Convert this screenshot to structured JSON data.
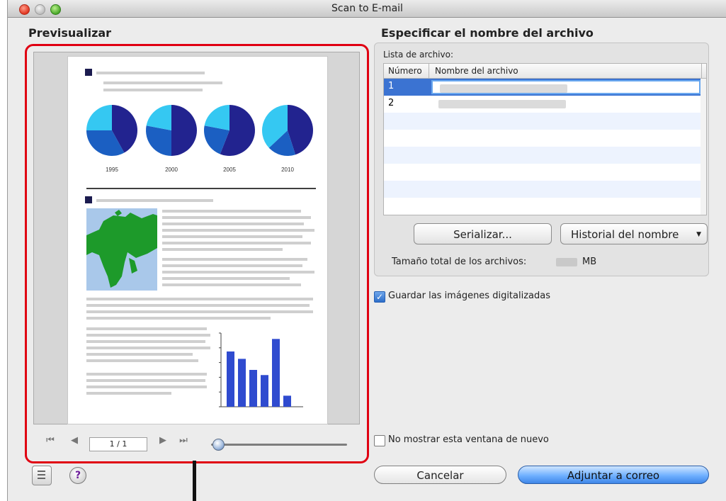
{
  "window": {
    "title": "Scan to E-mail"
  },
  "preview": {
    "section_title": "Previsualizar",
    "page_indicator": "1 / 1",
    "zoom_level": 0.05,
    "pie_years": [
      "1995",
      "2000",
      "2005",
      "2010"
    ],
    "bar_values": [
      75,
      65,
      50,
      43,
      92,
      15
    ]
  },
  "filename": {
    "section_title": "Especificar el nombre del archivo",
    "list_label": "Lista de archivo:",
    "columns": [
      "Número",
      "Nombre del archivo"
    ],
    "rows": [
      {
        "num": "1"
      },
      {
        "num": "2"
      }
    ],
    "serialize_button": "Serializar...",
    "history_button": "Historial del nombre",
    "total_size_label": "Tamaño total de los archivos:",
    "total_size_unit": "MB"
  },
  "options": {
    "save_images": "Guardar las imágenes digitalizadas",
    "save_images_checked": true,
    "dont_show": "No mostrar esta ventana de nuevo",
    "dont_show_checked": false
  },
  "actions": {
    "cancel": "Cancelar",
    "attach": "Adjuntar a correo"
  },
  "colors": {
    "accent": "#e00012",
    "pie_dark": "#22238f",
    "pie_mid": "#1b5fc2",
    "pie_light": "#35c8f2",
    "bar": "#2f4bcf",
    "map_land": "#1d9a2a",
    "map_sea": "#a9c8ea"
  },
  "icons": [
    "close-icon",
    "minimize-icon",
    "zoom-icon",
    "first-page-icon",
    "previous-page-icon",
    "next-page-icon",
    "last-page-icon",
    "sidebar-list-icon",
    "help-icon",
    "dropdown-triangle-icon",
    "checkmark-icon"
  ]
}
